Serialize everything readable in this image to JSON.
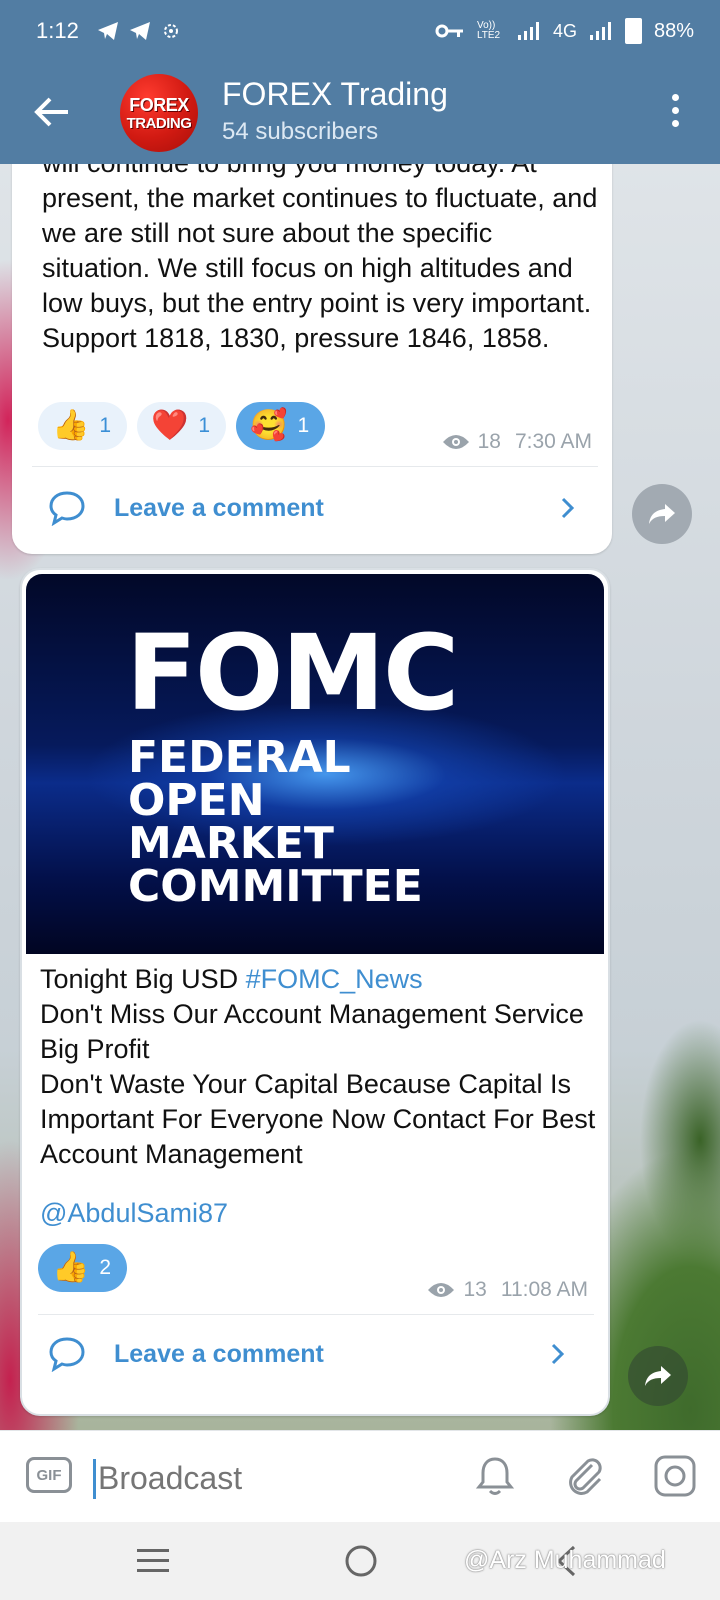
{
  "status_bar": {
    "time": "1:12",
    "network": "4G",
    "volte": "Vo)) LTE2",
    "battery": "88%"
  },
  "header": {
    "channel_name": "FOREX Trading",
    "subscribers": "54 subscribers",
    "avatar_line1": "FOREX",
    "avatar_line2": "TRADING"
  },
  "post1": {
    "text": "will continue to bring you money today. At present, the market continues to fluctuate, and we are still not sure about the specific situation. We still focus on high altitudes and low buys, but the entry point is very important.  Support 1818, 1830, pressure 1846, 1858.",
    "reactions": [
      {
        "emoji": "👍",
        "count": "1"
      },
      {
        "emoji": "❤️",
        "count": "1"
      },
      {
        "emoji": "🥰",
        "count": "1"
      }
    ],
    "views": "18",
    "time": "7:30 AM",
    "comment_label": "Leave a comment"
  },
  "post2": {
    "banner_title": "FOMC",
    "banner_line1": "FEDERAL",
    "banner_line2": "OPEN",
    "banner_line3": "MARKET",
    "banner_line4": "COMMITTEE",
    "text_prefix": "Tonight Big USD ",
    "hashtag": "#FOMC_News",
    "text_body": "Don't Miss Our Account Management Service Big Profit\nDon't Waste Your Capital Because Capital Is Important For Everyone Now Contact For Best Account Management",
    "mention": "@AbdulSami87",
    "reactions": [
      {
        "emoji": "👍",
        "count": "2"
      }
    ],
    "views": "13",
    "time": "11:08 AM",
    "comment_label": "Leave a comment"
  },
  "input": {
    "gif_label": "GIF",
    "placeholder": "Broadcast"
  },
  "watermark": "@Arz Muhammad",
  "colors": {
    "header": "#527da3",
    "accent": "#3f8ed0",
    "reaction_active": "#5aa6e6"
  }
}
